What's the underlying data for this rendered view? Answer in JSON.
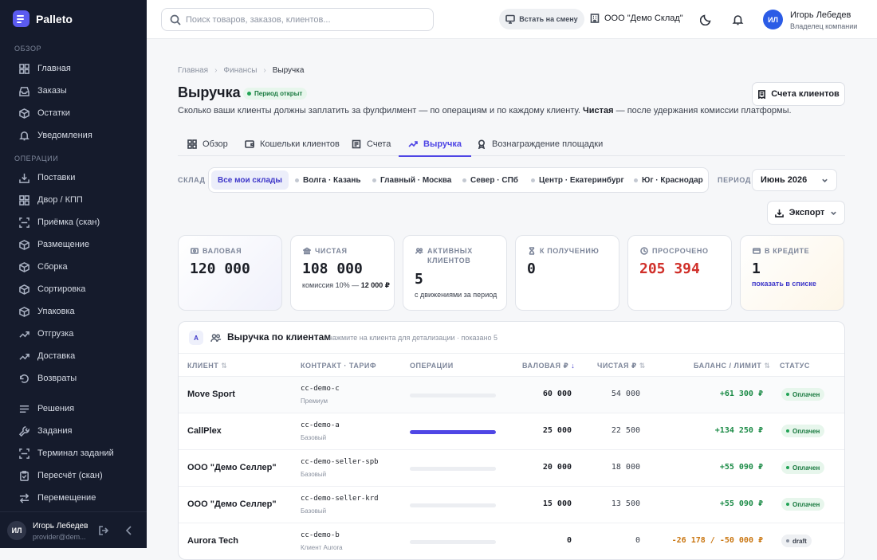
{
  "app": {
    "name": "Palleto"
  },
  "sidebar": {
    "sections": [
      {
        "title": "Обзор",
        "items": [
          {
            "label": "Главная",
            "icon": "grid-icon"
          },
          {
            "label": "Заказы",
            "icon": "inbox-icon"
          },
          {
            "label": "Остатки",
            "icon": "box-icon"
          },
          {
            "label": "Уведомления",
            "icon": "bell-icon"
          }
        ]
      },
      {
        "title": "Операции",
        "items": [
          {
            "label": "Поставки",
            "icon": "download-icon"
          },
          {
            "label": "Двор / КПП",
            "icon": "grid-icon"
          },
          {
            "label": "Приёмка (скан)",
            "icon": "scan-icon"
          },
          {
            "label": "Размещение",
            "icon": "box-icon"
          },
          {
            "label": "Сборка",
            "icon": "box-icon"
          },
          {
            "label": "Сортировка",
            "icon": "box-icon"
          },
          {
            "label": "Упаковка",
            "icon": "box-icon"
          },
          {
            "label": "Отгрузка",
            "icon": "trend-icon"
          },
          {
            "label": "Доставка",
            "icon": "trend-icon"
          },
          {
            "label": "Возвраты",
            "icon": "undo-icon"
          }
        ]
      },
      {
        "title": "",
        "items": [
          {
            "label": "Решения",
            "icon": "list-icon"
          },
          {
            "label": "Задания",
            "icon": "wrench-icon"
          },
          {
            "label": "Терминал заданий",
            "icon": "scan-icon"
          },
          {
            "label": "Пересчёт (скан)",
            "icon": "clipboard-icon"
          },
          {
            "label": "Перемещение",
            "icon": "arrows-icon"
          }
        ]
      }
    ],
    "user": {
      "initials": "ИЛ",
      "name": "Игорь Лебедев",
      "email": "provider@dem..."
    }
  },
  "topbar": {
    "search_placeholder": "Поиск товаров, заказов, клиентов...",
    "shift_button": "Встать на смену",
    "company": "ООО \"Демо Склад\"",
    "user": {
      "initials": "ИЛ",
      "name": "Игорь Лебедев",
      "role": "Владелец компании"
    }
  },
  "page": {
    "breadcrumbs": [
      "Главная",
      "Финансы",
      "Выручка"
    ],
    "title": "Выручка",
    "badge": "Период открыт",
    "subtitle_pre": "Сколько ваши клиенты должны заплатить за фулфилмент — по операциям и по каждому клиенту. ",
    "subtitle_bold": "Чистая",
    "subtitle_post": " — после удержания комиссии платформы.",
    "invoices_button": "Счета клиентов"
  },
  "tabs": [
    {
      "label": "Обзор",
      "icon": "grid-icon",
      "active": false
    },
    {
      "label": "Кошельки клиентов",
      "icon": "wallet-icon",
      "active": false
    },
    {
      "label": "Счета",
      "icon": "receipt-icon",
      "active": false
    },
    {
      "label": "Выручка",
      "icon": "trend-icon",
      "active": true
    },
    {
      "label": "Вознаграждение площадки",
      "icon": "award-icon",
      "active": false
    }
  ],
  "filters": {
    "warehouse_label": "Склад",
    "warehouses": [
      "Все мои склады",
      "Волга · Казань",
      "Главный · Москва",
      "Север · СПб",
      "Центр · Екатеринбург",
      "Юг · Краснодар"
    ],
    "active_warehouse": 0,
    "period_label": "Период",
    "period_value": "Июнь 2026",
    "export_button": "Экспорт"
  },
  "kpis": [
    {
      "label": "Валовая",
      "value": "120 000"
    },
    {
      "label": "Чистая",
      "value": "108 000",
      "note_pre": "комиссия 10% — ",
      "note_bold": "12 000 ₽"
    },
    {
      "label": "Активных клиентов",
      "value": "5",
      "note": "с движениями за период"
    },
    {
      "label": "К получению",
      "value": "0"
    },
    {
      "label": "Просрочено",
      "value": "205 394"
    },
    {
      "label": "В кредите",
      "value": "1",
      "link": "показать в списке"
    }
  ],
  "table": {
    "badge": "A",
    "title": "Выручка по клиентам",
    "hint": "нажмите на клиента для детализации · показано 5",
    "columns": [
      "Клиент",
      "Контракт · Тариф",
      "Операции",
      "Валовая ₽",
      "Чистая ₽",
      "Баланс / Лимит",
      "Статус"
    ],
    "rows": [
      {
        "client": "Move Sport",
        "code": "cc-demo-c",
        "tariff": "Премиум",
        "ops": 0.0,
        "gross": "60 000",
        "net": "54 000",
        "balance": "+61 300 ₽",
        "balance_tone": "green",
        "status": "Оплачен"
      },
      {
        "client": "CallPlex",
        "code": "cc-demo-a",
        "tariff": "Базовый",
        "ops": 1.0,
        "gross": "25 000",
        "net": "22 500",
        "balance": "+134 250 ₽",
        "balance_tone": "green",
        "status": "Оплачен"
      },
      {
        "client": "ООО \"Демо Селлер\"",
        "code": "cc-demo-seller-spb",
        "tariff": "Базовый",
        "ops": 0.0,
        "gross": "20 000",
        "net": "18 000",
        "balance": "+55 090 ₽",
        "balance_tone": "green",
        "status": "Оплачен"
      },
      {
        "client": "ООО \"Демо Селлер\"",
        "code": "cc-demo-seller-krd",
        "tariff": "Базовый",
        "ops": 0.0,
        "gross": "15 000",
        "net": "13 500",
        "balance": "+55 090 ₽",
        "balance_tone": "green",
        "status": "Оплачен"
      },
      {
        "client": "Aurora Tech",
        "code": "cc-demo-b",
        "tariff": "Клиент Aurora",
        "ops": 0.0,
        "gross": "0",
        "net": "0",
        "balance": "-26 178 / -50 000 ₽",
        "balance_tone": "orange",
        "status": "draft"
      }
    ]
  },
  "colors": {
    "accent": "#4f46e5",
    "sidebar": "#151b2c",
    "success": "#1a8a45",
    "danger": "#d0302a",
    "warning": "#c9750f"
  }
}
